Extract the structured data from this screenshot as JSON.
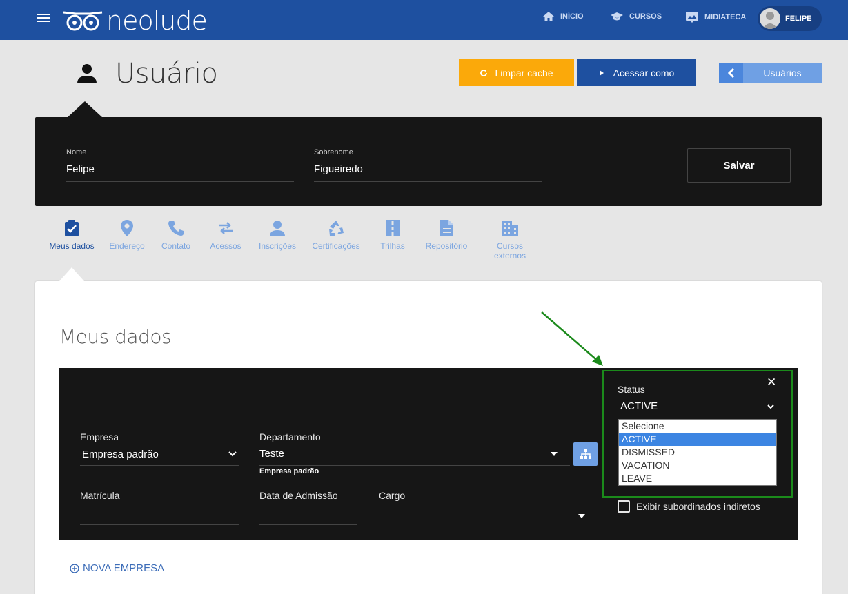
{
  "topbar": {
    "logo_text": "neolude",
    "nav": [
      {
        "label": "INÍCIO",
        "icon": "home-icon"
      },
      {
        "label": "CURSOS",
        "icon": "graduation-cap-icon"
      },
      {
        "label": "MIDIATECA",
        "icon": "media-library-icon"
      }
    ],
    "user_name": "FELIPE"
  },
  "page": {
    "title": "Usuário",
    "btn_cache": "Limpar cache",
    "btn_access": "Acessar como",
    "btn_users": "Usuários"
  },
  "name_panel": {
    "nome_label": "Nome",
    "nome_value": "Felipe",
    "sobrenome_label": "Sobrenome",
    "sobrenome_value": "Figueiredo",
    "save_label": "Salvar"
  },
  "tabs": [
    {
      "label": "Meus dados",
      "icon": "clipboard-check-icon",
      "active": true
    },
    {
      "label": "Endereço",
      "icon": "location-pin-icon"
    },
    {
      "label": "Contato",
      "icon": "phone-icon"
    },
    {
      "label": "Acessos",
      "icon": "swap-arrows-icon"
    },
    {
      "label": "Inscrições",
      "icon": "person-icon"
    },
    {
      "label": "Certificações",
      "icon": "recycle-icon"
    },
    {
      "label": "Trilhas",
      "icon": "road-icon"
    },
    {
      "label": "Repositório",
      "icon": "document-icon"
    },
    {
      "label": "Cursos\nexternos",
      "icon": "building-icon"
    }
  ],
  "section": {
    "title": "Meus dados",
    "empresa_label": "Empresa",
    "empresa_value": "Empresa padrão",
    "departamento_label": "Departamento",
    "departamento_value": "Teste",
    "departamento_note": "Empresa padrão",
    "matricula_label": "Matrícula",
    "matricula_value": "",
    "admissao_label": "Data de Admissão",
    "admissao_value": "",
    "cargo_label": "Cargo",
    "cargo_value": "",
    "status_label": "Status",
    "status_value": "ACTIVE",
    "status_options": [
      "Selecione",
      "ACTIVE",
      "DISMISSED",
      "VACATION",
      "LEAVE"
    ],
    "status_selected": "ACTIVE",
    "indirect_label": "Exibir subordinados indiretos",
    "nova_empresa": "NOVA EMPRESA"
  },
  "colors": {
    "brand_blue": "#1e50a0",
    "accent_orange": "#fba90a",
    "light_blue": "#6fa0e4",
    "highlight_green": "#1b8a1b"
  }
}
